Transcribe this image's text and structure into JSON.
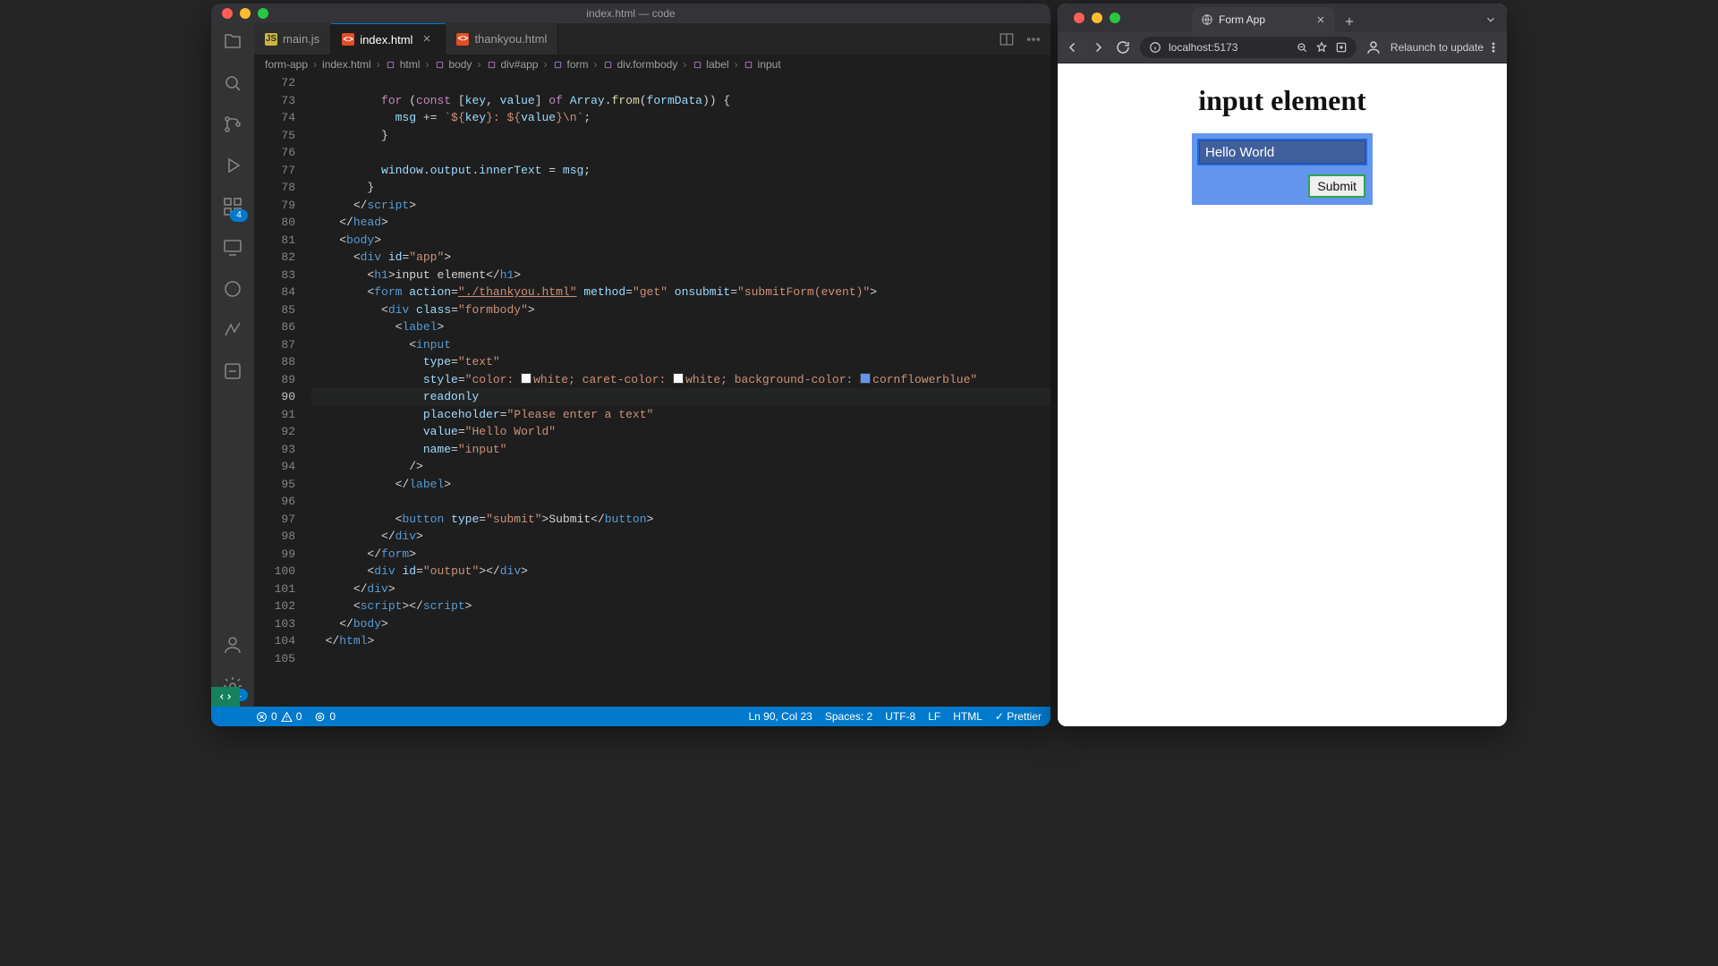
{
  "vscode": {
    "title": "index.html — code",
    "tabs": [
      {
        "label": "main.js",
        "icon": "JS",
        "active": false,
        "closeable": false
      },
      {
        "label": "index.html",
        "icon": "<>",
        "active": true,
        "closeable": true
      },
      {
        "label": "thankyou.html",
        "icon": "<>",
        "active": false,
        "closeable": false
      }
    ],
    "breadcrumbs": [
      {
        "label": "form-app"
      },
      {
        "label": "index.html"
      },
      {
        "label": "html"
      },
      {
        "label": "body"
      },
      {
        "label": "div#app"
      },
      {
        "label": "form"
      },
      {
        "label": "div.formbody"
      },
      {
        "label": "label"
      },
      {
        "label": "input"
      }
    ],
    "activity_badges": {
      "extensions": "4",
      "settings": "1"
    },
    "status": {
      "errors": "0",
      "warnings": "0",
      "ports": "0",
      "cursor": "Ln 90, Col 23",
      "spaces": "Spaces: 2",
      "encoding": "UTF-8",
      "eol": "LF",
      "language": "HTML",
      "formatter": "✓ Prettier"
    },
    "code_lines": [
      {
        "n": 72,
        "indent": 10,
        "tokens": []
      },
      {
        "n": 73,
        "indent": 10,
        "tokens": [
          {
            "t": "kw",
            "v": "for"
          },
          {
            "t": "p",
            "v": " ("
          },
          {
            "t": "kw",
            "v": "const"
          },
          {
            "t": "p",
            "v": " ["
          },
          {
            "t": "var",
            "v": "key"
          },
          {
            "t": "p",
            "v": ", "
          },
          {
            "t": "var",
            "v": "value"
          },
          {
            "t": "p",
            "v": "] "
          },
          {
            "t": "kw",
            "v": "of"
          },
          {
            "t": "p",
            "v": " "
          },
          {
            "t": "var",
            "v": "Array"
          },
          {
            "t": "p",
            "v": "."
          },
          {
            "t": "fn",
            "v": "from"
          },
          {
            "t": "p",
            "v": "("
          },
          {
            "t": "var",
            "v": "formData"
          },
          {
            "t": "p",
            "v": ")) {"
          }
        ]
      },
      {
        "n": 74,
        "indent": 12,
        "tokens": [
          {
            "t": "var",
            "v": "msg"
          },
          {
            "t": "p",
            "v": " += "
          },
          {
            "t": "str",
            "v": "`${"
          },
          {
            "t": "var",
            "v": "key"
          },
          {
            "t": "str",
            "v": "}: ${"
          },
          {
            "t": "var",
            "v": "value"
          },
          {
            "t": "str",
            "v": "}\\n`"
          },
          {
            "t": "p",
            "v": ";"
          }
        ]
      },
      {
        "n": 75,
        "indent": 10,
        "tokens": [
          {
            "t": "p",
            "v": "}"
          }
        ]
      },
      {
        "n": 76,
        "indent": 10,
        "tokens": []
      },
      {
        "n": 77,
        "indent": 10,
        "tokens": [
          {
            "t": "var",
            "v": "window"
          },
          {
            "t": "p",
            "v": "."
          },
          {
            "t": "var",
            "v": "output"
          },
          {
            "t": "p",
            "v": "."
          },
          {
            "t": "var",
            "v": "innerText"
          },
          {
            "t": "p",
            "v": " = "
          },
          {
            "t": "var",
            "v": "msg"
          },
          {
            "t": "p",
            "v": ";"
          }
        ]
      },
      {
        "n": 78,
        "indent": 8,
        "tokens": [
          {
            "t": "p",
            "v": "}"
          }
        ]
      },
      {
        "n": 79,
        "indent": 6,
        "tokens": [
          {
            "t": "p",
            "v": "</"
          },
          {
            "t": "tag",
            "v": "script"
          },
          {
            "t": "p",
            "v": ">"
          }
        ]
      },
      {
        "n": 80,
        "indent": 4,
        "tokens": [
          {
            "t": "p",
            "v": "</"
          },
          {
            "t": "tag",
            "v": "head"
          },
          {
            "t": "p",
            "v": ">"
          }
        ]
      },
      {
        "n": 81,
        "indent": 4,
        "tokens": [
          {
            "t": "p",
            "v": "<"
          },
          {
            "t": "tag",
            "v": "body"
          },
          {
            "t": "p",
            "v": ">"
          }
        ]
      },
      {
        "n": 82,
        "indent": 6,
        "tokens": [
          {
            "t": "p",
            "v": "<"
          },
          {
            "t": "tag",
            "v": "div"
          },
          {
            "t": "p",
            "v": " "
          },
          {
            "t": "attr",
            "v": "id"
          },
          {
            "t": "p",
            "v": "="
          },
          {
            "t": "str",
            "v": "\"app\""
          },
          {
            "t": "p",
            "v": ">"
          }
        ]
      },
      {
        "n": 83,
        "indent": 8,
        "tokens": [
          {
            "t": "p",
            "v": "<"
          },
          {
            "t": "tag",
            "v": "h1"
          },
          {
            "t": "p",
            "v": ">"
          },
          {
            "t": "p",
            "v": "input element"
          },
          {
            "t": "p",
            "v": "</"
          },
          {
            "t": "tag",
            "v": "h1"
          },
          {
            "t": "p",
            "v": ">"
          }
        ]
      },
      {
        "n": 84,
        "indent": 8,
        "tokens": [
          {
            "t": "p",
            "v": "<"
          },
          {
            "t": "tag",
            "v": "form"
          },
          {
            "t": "p",
            "v": " "
          },
          {
            "t": "attr",
            "v": "action"
          },
          {
            "t": "p",
            "v": "="
          },
          {
            "t": "str",
            "v": "\"./thankyou.html\"",
            "u": true
          },
          {
            "t": "p",
            "v": " "
          },
          {
            "t": "attr",
            "v": "method"
          },
          {
            "t": "p",
            "v": "="
          },
          {
            "t": "str",
            "v": "\"get\""
          },
          {
            "t": "p",
            "v": " "
          },
          {
            "t": "attr",
            "v": "onsubmit"
          },
          {
            "t": "p",
            "v": "="
          },
          {
            "t": "str",
            "v": "\"submitForm(event)\""
          },
          {
            "t": "p",
            "v": ">"
          }
        ]
      },
      {
        "n": 85,
        "indent": 10,
        "tokens": [
          {
            "t": "p",
            "v": "<"
          },
          {
            "t": "tag",
            "v": "div"
          },
          {
            "t": "p",
            "v": " "
          },
          {
            "t": "attr",
            "v": "class"
          },
          {
            "t": "p",
            "v": "="
          },
          {
            "t": "str",
            "v": "\"formbody\""
          },
          {
            "t": "p",
            "v": ">"
          }
        ]
      },
      {
        "n": 86,
        "indent": 12,
        "tokens": [
          {
            "t": "p",
            "v": "<"
          },
          {
            "t": "tag",
            "v": "label"
          },
          {
            "t": "p",
            "v": ">"
          }
        ]
      },
      {
        "n": 87,
        "indent": 14,
        "tokens": [
          {
            "t": "p",
            "v": "<"
          },
          {
            "t": "tag",
            "v": "input"
          }
        ]
      },
      {
        "n": 88,
        "indent": 16,
        "tokens": [
          {
            "t": "attr",
            "v": "type"
          },
          {
            "t": "p",
            "v": "="
          },
          {
            "t": "str",
            "v": "\"text\""
          }
        ]
      },
      {
        "n": 89,
        "indent": 16,
        "tokens": [
          {
            "t": "attr",
            "v": "style"
          },
          {
            "t": "p",
            "v": "="
          },
          {
            "t": "str",
            "v": "\"color: "
          },
          {
            "t": "sw",
            "c": "#ffffff"
          },
          {
            "t": "str",
            "v": "white; caret-color: "
          },
          {
            "t": "sw",
            "c": "#ffffff"
          },
          {
            "t": "str",
            "v": "white; background-color: "
          },
          {
            "t": "sw",
            "c": "#6495ed"
          },
          {
            "t": "str",
            "v": "cornflowerblue\""
          }
        ]
      },
      {
        "n": 90,
        "indent": 16,
        "cur": true,
        "tokens": [
          {
            "t": "attr",
            "v": "readonly"
          }
        ]
      },
      {
        "n": 91,
        "indent": 16,
        "tokens": [
          {
            "t": "attr",
            "v": "placeholder"
          },
          {
            "t": "p",
            "v": "="
          },
          {
            "t": "str",
            "v": "\"Please enter a text\""
          }
        ]
      },
      {
        "n": 92,
        "indent": 16,
        "tokens": [
          {
            "t": "attr",
            "v": "value"
          },
          {
            "t": "p",
            "v": "="
          },
          {
            "t": "str",
            "v": "\"Hello World\""
          }
        ]
      },
      {
        "n": 93,
        "indent": 16,
        "tokens": [
          {
            "t": "attr",
            "v": "name"
          },
          {
            "t": "p",
            "v": "="
          },
          {
            "t": "str",
            "v": "\"input\""
          }
        ]
      },
      {
        "n": 94,
        "indent": 14,
        "tokens": [
          {
            "t": "p",
            "v": "/>"
          }
        ]
      },
      {
        "n": 95,
        "indent": 12,
        "tokens": [
          {
            "t": "p",
            "v": "</"
          },
          {
            "t": "tag",
            "v": "label"
          },
          {
            "t": "p",
            "v": ">"
          }
        ]
      },
      {
        "n": 96,
        "indent": 12,
        "tokens": []
      },
      {
        "n": 97,
        "indent": 12,
        "tokens": [
          {
            "t": "p",
            "v": "<"
          },
          {
            "t": "tag",
            "v": "button"
          },
          {
            "t": "p",
            "v": " "
          },
          {
            "t": "attr",
            "v": "type"
          },
          {
            "t": "p",
            "v": "="
          },
          {
            "t": "str",
            "v": "\"submit\""
          },
          {
            "t": "p",
            "v": ">"
          },
          {
            "t": "p",
            "v": "Submit"
          },
          {
            "t": "p",
            "v": "</"
          },
          {
            "t": "tag",
            "v": "button"
          },
          {
            "t": "p",
            "v": ">"
          }
        ]
      },
      {
        "n": 98,
        "indent": 10,
        "tokens": [
          {
            "t": "p",
            "v": "</"
          },
          {
            "t": "tag",
            "v": "div"
          },
          {
            "t": "p",
            "v": ">"
          }
        ]
      },
      {
        "n": 99,
        "indent": 8,
        "tokens": [
          {
            "t": "p",
            "v": "</"
          },
          {
            "t": "tag",
            "v": "form"
          },
          {
            "t": "p",
            "v": ">"
          }
        ]
      },
      {
        "n": 100,
        "indent": 8,
        "tokens": [
          {
            "t": "p",
            "v": "<"
          },
          {
            "t": "tag",
            "v": "div"
          },
          {
            "t": "p",
            "v": " "
          },
          {
            "t": "attr",
            "v": "id"
          },
          {
            "t": "p",
            "v": "="
          },
          {
            "t": "str",
            "v": "\"output\""
          },
          {
            "t": "p",
            "v": ">"
          },
          {
            "t": "p",
            "v": "</"
          },
          {
            "t": "tag",
            "v": "div"
          },
          {
            "t": "p",
            "v": ">"
          }
        ]
      },
      {
        "n": 101,
        "indent": 6,
        "tokens": [
          {
            "t": "p",
            "v": "</"
          },
          {
            "t": "tag",
            "v": "div"
          },
          {
            "t": "p",
            "v": ">"
          }
        ]
      },
      {
        "n": 102,
        "indent": 6,
        "tokens": [
          {
            "t": "p",
            "v": "<"
          },
          {
            "t": "tag",
            "v": "script"
          },
          {
            "t": "p",
            "v": ">"
          },
          {
            "t": "p",
            "v": "</"
          },
          {
            "t": "tag",
            "v": "script"
          },
          {
            "t": "p",
            "v": ">"
          }
        ]
      },
      {
        "n": 103,
        "indent": 4,
        "tokens": [
          {
            "t": "p",
            "v": "</"
          },
          {
            "t": "tag",
            "v": "body"
          },
          {
            "t": "p",
            "v": ">"
          }
        ]
      },
      {
        "n": 104,
        "indent": 2,
        "tokens": [
          {
            "t": "p",
            "v": "</"
          },
          {
            "t": "tag",
            "v": "html"
          },
          {
            "t": "p",
            "v": ">"
          }
        ]
      },
      {
        "n": 105,
        "indent": 0,
        "tokens": []
      }
    ]
  },
  "chrome": {
    "tab_title": "Form App",
    "url": "localhost:5173",
    "relaunch_label": "Relaunch to update",
    "page": {
      "heading": "input element",
      "input_value": "Hello World",
      "input_placeholder": "Please enter a text",
      "submit_label": "Submit"
    }
  }
}
